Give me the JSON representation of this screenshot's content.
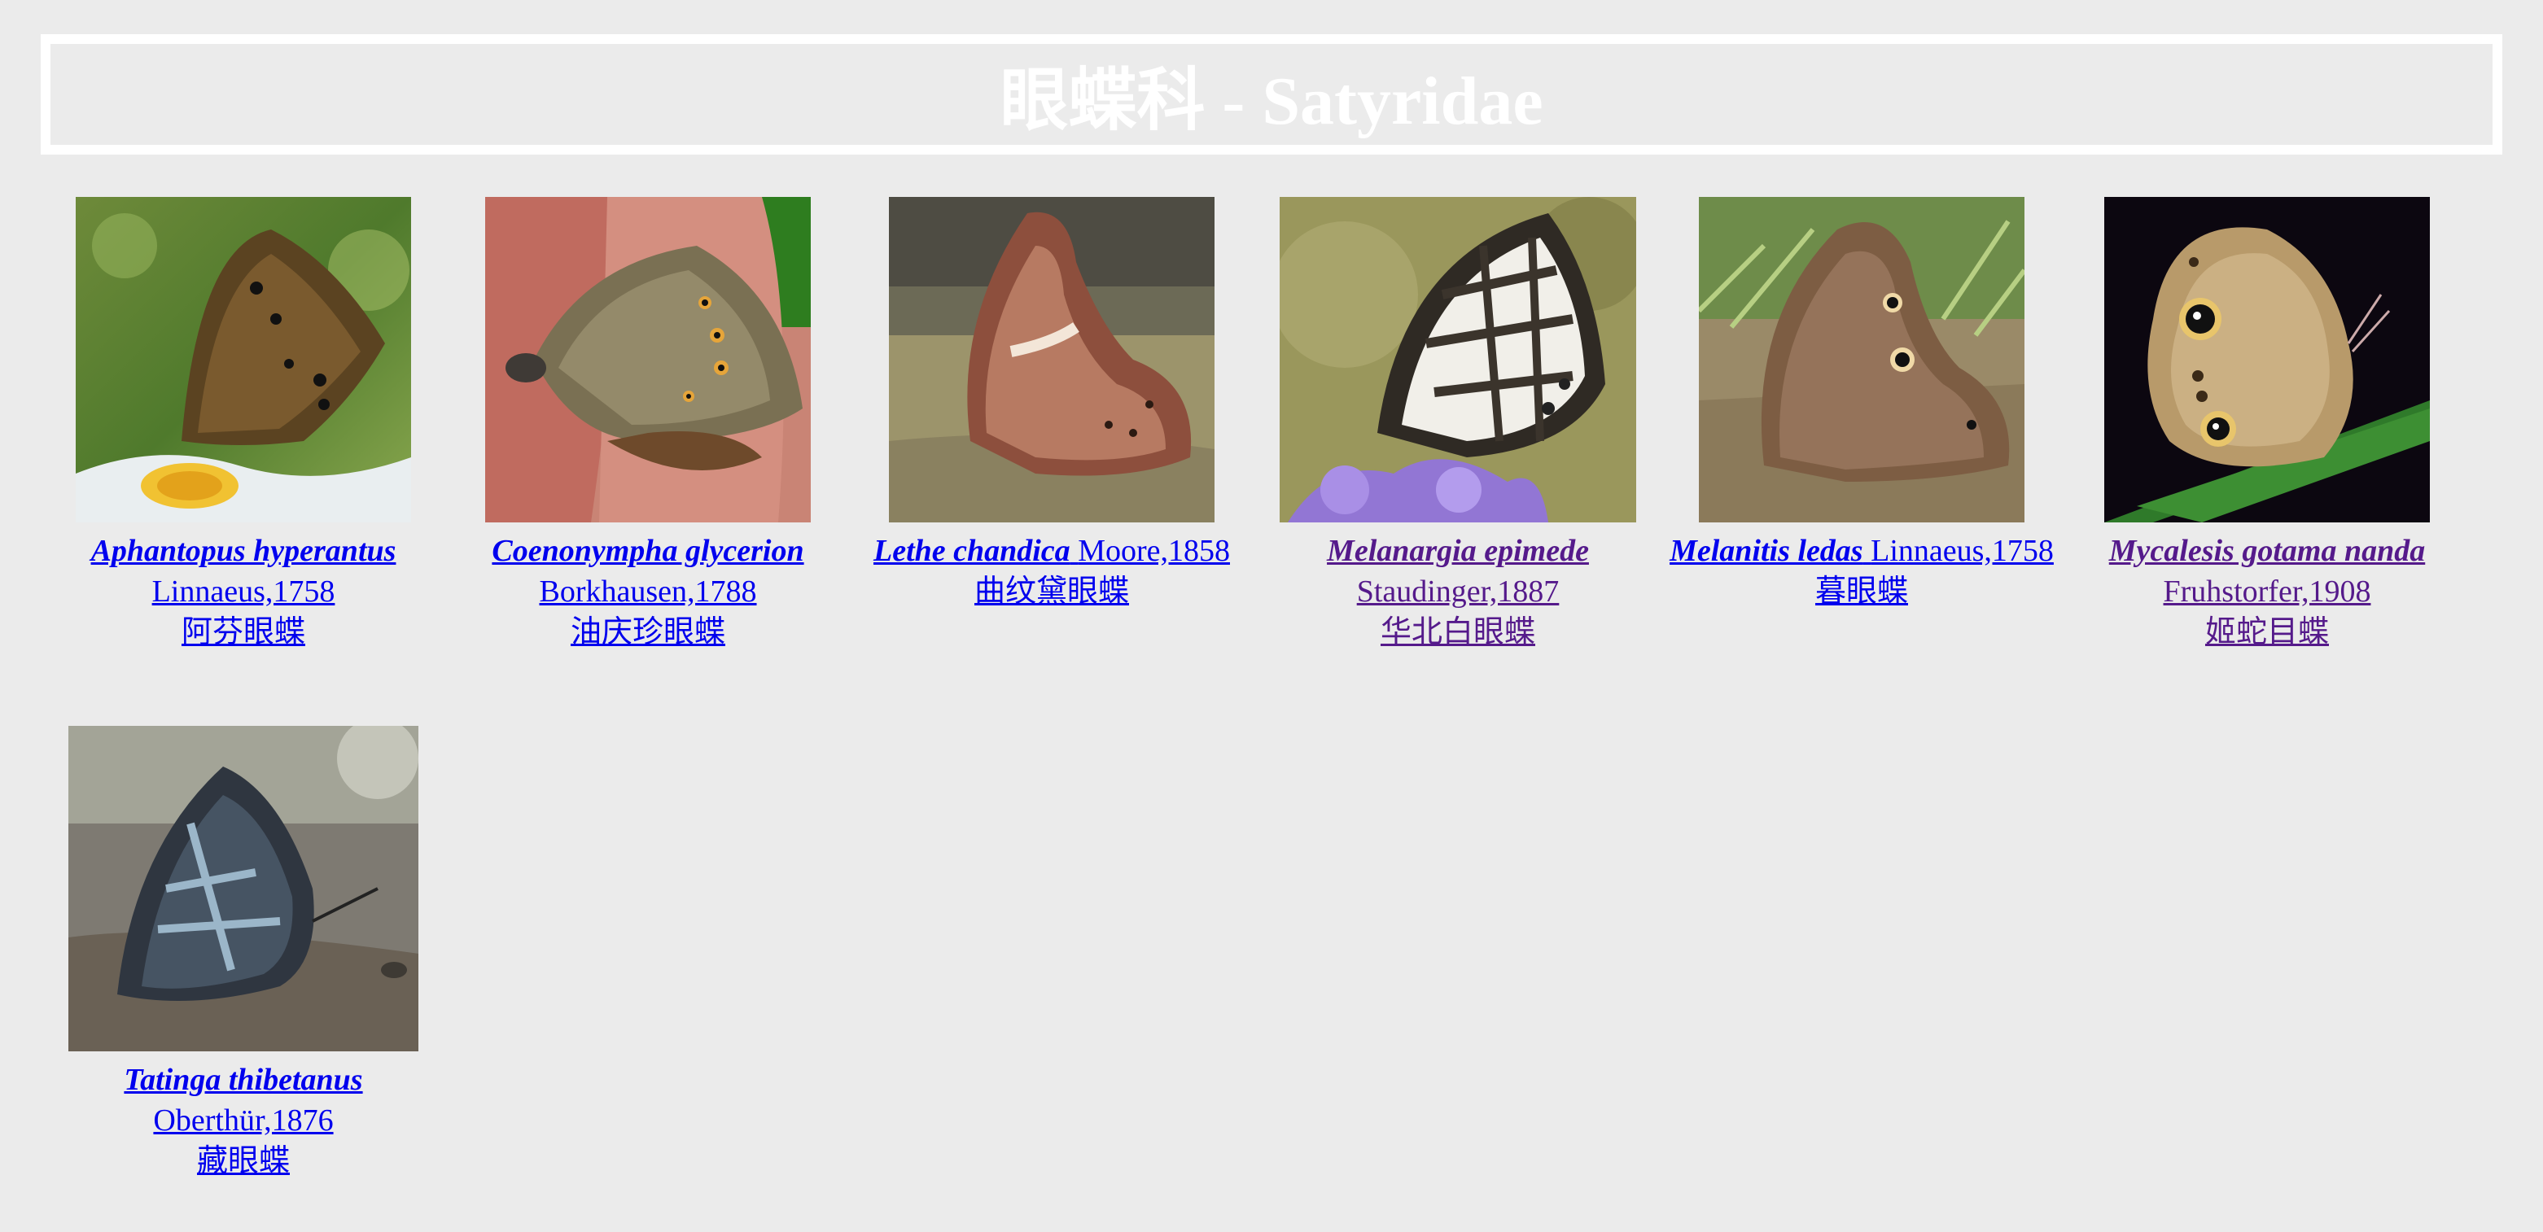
{
  "page": {
    "title": "眼蝶科 - Satyridae"
  },
  "species": [
    {
      "scientific_name": "Aphantopus hyperantus",
      "author": "Linnaeus,1758",
      "chinese_name": "阿芬眼蝶",
      "visited": false,
      "image_icon": "butterfly-on-white-flower-photo"
    },
    {
      "scientific_name": "Coenonympha glycerion",
      "author": "Borkhausen,1788",
      "chinese_name": "油庆珍眼蝶",
      "visited": false,
      "image_icon": "butterfly-on-fingers-photo"
    },
    {
      "scientific_name": "Lethe chandica",
      "author": "Moore,1858",
      "chinese_name": "曲纹黛眼蝶",
      "visited": false,
      "image_icon": "brown-butterfly-on-ground-photo"
    },
    {
      "scientific_name": "Melanargia epimede",
      "author": "Staudinger,1887",
      "chinese_name": "华北白眼蝶",
      "visited": true,
      "image_icon": "marbled-white-butterfly-on-purple-flower-photo"
    },
    {
      "scientific_name": "Melanitis ledas",
      "author": "Linnaeus,1758",
      "chinese_name": "暮眼蝶",
      "visited": false,
      "image_icon": "brown-butterfly-on-grass-photo"
    },
    {
      "scientific_name": "Mycalesis gotama nanda",
      "author": "Fruhstorfer,1908",
      "chinese_name": "姬蛇目蝶",
      "visited": true,
      "image_icon": "eyespot-butterfly-on-leaf-photo"
    },
    {
      "scientific_name": "Tatinga thibetanus",
      "author": "Oberthür,1876",
      "chinese_name": "藏眼蝶",
      "visited": false,
      "image_icon": "dark-checkered-butterfly-on-soil-photo"
    }
  ],
  "colors": {
    "background": "#ebebeb",
    "title_text": "#ffffff",
    "link": "#0000ee",
    "visited_link": "#551a8b"
  }
}
